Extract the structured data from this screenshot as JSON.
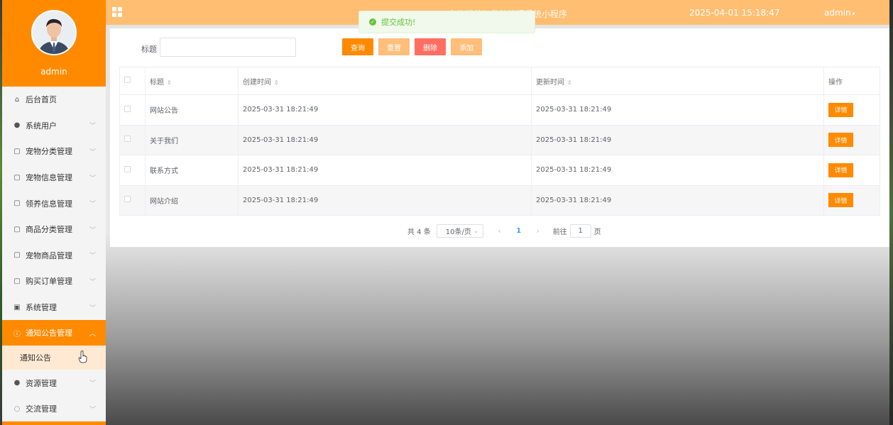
{
  "sidebar": {
    "username": "admin",
    "items": [
      {
        "label": "后台首页",
        "icon": "home-icon",
        "glyph": "⌂",
        "chevron": false
      },
      {
        "label": "系统用户",
        "icon": "user-icon",
        "glyph": "●",
        "chevron": true
      },
      {
        "label": "宠物分类管理",
        "icon": "doc-icon",
        "glyph": "▢",
        "chevron": true
      },
      {
        "label": "宠物信息管理",
        "icon": "doc-icon",
        "glyph": "▢",
        "chevron": true
      },
      {
        "label": "领养信息管理",
        "icon": "doc-icon",
        "glyph": "▢",
        "chevron": true
      },
      {
        "label": "商品分类管理",
        "icon": "doc-icon",
        "glyph": "▢",
        "chevron": true
      },
      {
        "label": "宠物商品管理",
        "icon": "doc-icon",
        "glyph": "▢",
        "chevron": true
      },
      {
        "label": "购买订单管理",
        "icon": "doc-icon",
        "glyph": "▢",
        "chevron": true
      },
      {
        "label": "系统管理",
        "icon": "picture-icon",
        "glyph": "▣",
        "chevron": true
      },
      {
        "label": "通知公告管理",
        "icon": "info-icon",
        "glyph": "ⓘ",
        "chevron": true,
        "active": true,
        "expanded": true
      },
      {
        "label": "资源管理",
        "icon": "location-icon",
        "glyph": "●",
        "chevron": true
      },
      {
        "label": "交流管理",
        "icon": "chat-icon",
        "glyph": "◌",
        "chevron": true
      }
    ],
    "submenu": {
      "label": "通知公告"
    }
  },
  "topbar": {
    "title": "宠物领养与救助管理系统小程序",
    "datetime": "2025-04-01 15:18:47",
    "user": "admin"
  },
  "toast": {
    "message": "提交成功!",
    "color": "#67c23a"
  },
  "search": {
    "label": "标题",
    "placeholder": "",
    "buttons": {
      "query": "查询",
      "reset": "重置",
      "delete": "删除",
      "add": "添加"
    }
  },
  "table": {
    "headers": {
      "title": "标题",
      "created": "创建时间",
      "updated": "更新时间",
      "actions": "操作"
    },
    "rows": [
      {
        "title": "网站公告",
        "created": "2025-03-31 18:21:49",
        "updated": "2025-03-31 18:21:49",
        "action": "详情"
      },
      {
        "title": "关于我们",
        "created": "2025-03-31 18:21:49",
        "updated": "2025-03-31 18:21:49",
        "action": "详情"
      },
      {
        "title": "联系方式",
        "created": "2025-03-31 18:21:49",
        "updated": "2025-03-31 18:21:49",
        "action": "详情"
      },
      {
        "title": "网站介绍",
        "created": "2025-03-31 18:21:49",
        "updated": "2025-03-31 18:21:49",
        "action": "详情"
      }
    ]
  },
  "pagination": {
    "total": "共 4 条",
    "page_size": "10条/页",
    "current": "1",
    "goto_label": "前往",
    "goto_value": "1",
    "goto_suffix": "页"
  },
  "colors": {
    "accent": "#ff8a00",
    "topbar": "#ffbe71",
    "danger": "#ff6f61",
    "light_accent": "#ffbe7a"
  }
}
